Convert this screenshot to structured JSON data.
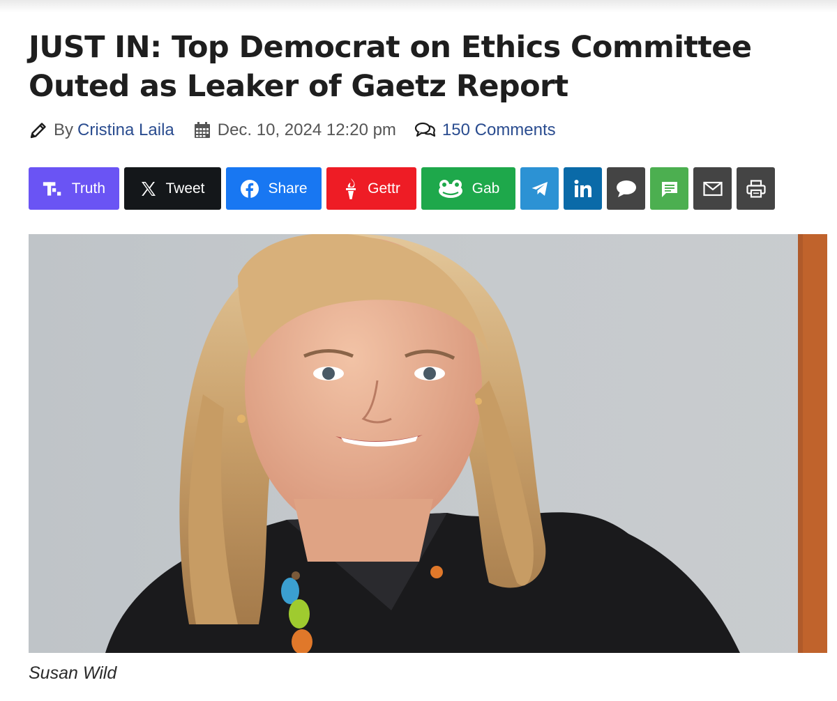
{
  "article": {
    "headline": "JUST IN: Top Democrat on Ethics Committee Outed as Leaker of Gaetz Report",
    "byline_prefix": "By",
    "author": "Cristina Laila",
    "date": "Dec. 10, 2024 12:20 pm",
    "comments": "150 Comments",
    "caption": "Susan Wild"
  },
  "share": {
    "truth": {
      "label": "Truth",
      "color": "#6a54f4"
    },
    "tweet": {
      "label": "Tweet",
      "color": "#14171a"
    },
    "facebook": {
      "label": "Share",
      "color": "#1877f2"
    },
    "gettr": {
      "label": "Gettr",
      "color": "#ee1c25"
    },
    "gab": {
      "label": "Gab",
      "color": "#1ea84b"
    },
    "telegram": {
      "color": "#2c92d4"
    },
    "linkedin": {
      "color": "#0a6aa8"
    },
    "comment": {
      "color": "#444444"
    },
    "sms": {
      "color": "#4caf50"
    },
    "email": {
      "color": "#444444"
    },
    "print": {
      "color": "#444444"
    }
  },
  "icons": {
    "author": "pencil-icon",
    "date": "calendar-icon",
    "comments": "chat-bubbles-icon"
  }
}
